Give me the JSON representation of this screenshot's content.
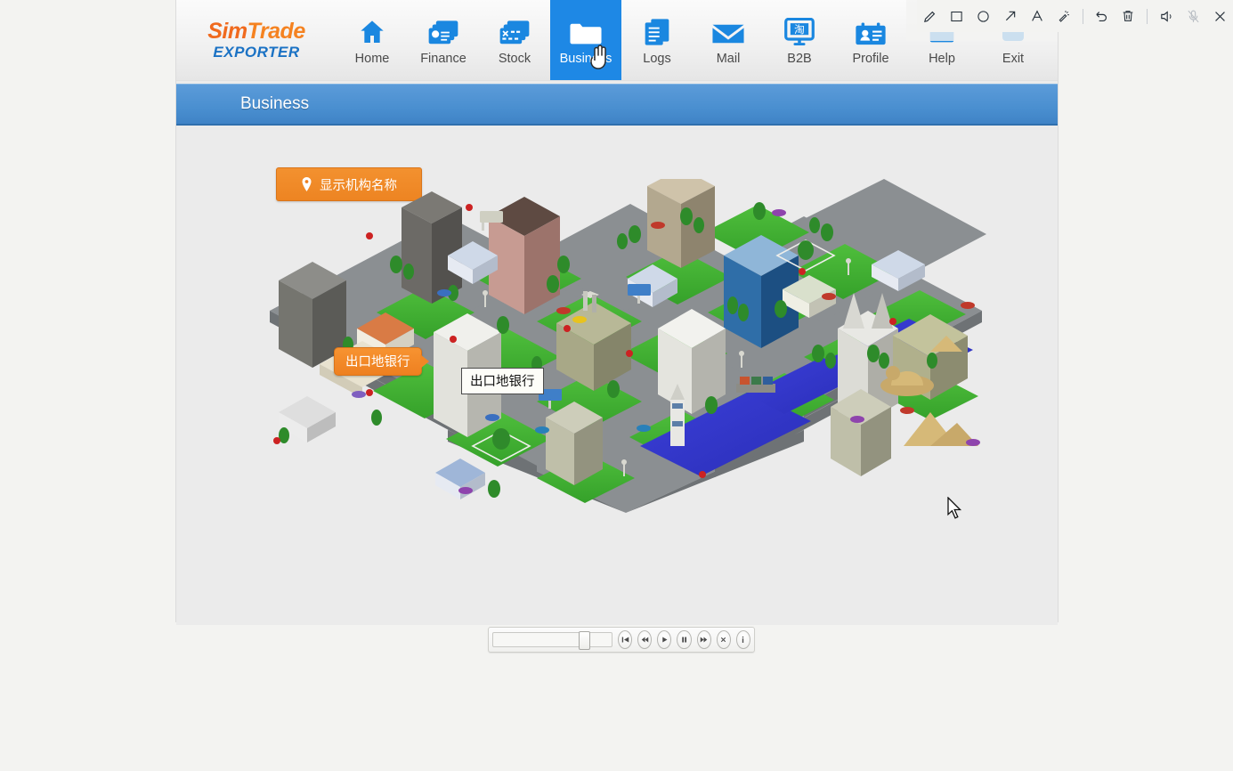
{
  "recorder_toolbar": {
    "buttons": [
      {
        "name": "pencil-icon",
        "label": "Pencil",
        "enabled": true
      },
      {
        "name": "rectangle-icon",
        "label": "Rectangle",
        "enabled": true
      },
      {
        "name": "ellipse-icon",
        "label": "Ellipse",
        "enabled": true
      },
      {
        "name": "arrow-icon",
        "label": "Arrow",
        "enabled": true
      },
      {
        "name": "text-icon",
        "label": "A",
        "enabled": true
      },
      {
        "name": "magic-wand-icon",
        "label": "Highlight",
        "enabled": true
      },
      {
        "name": "undo-icon",
        "label": "Undo",
        "enabled": true
      },
      {
        "name": "trash-icon",
        "label": "Delete",
        "enabled": true
      },
      {
        "name": "speaker-icon",
        "label": "Speaker",
        "enabled": true
      },
      {
        "name": "microphone-muted-icon",
        "label": "Microphone muted",
        "enabled": false
      },
      {
        "name": "close-icon",
        "label": "Close",
        "enabled": true
      }
    ]
  },
  "app": {
    "logo": {
      "line1_a": "Sim",
      "line1_b": "Trade",
      "line2": "EXPORTER"
    },
    "nav": {
      "items": [
        {
          "label": "Home",
          "icon": "home-icon",
          "active": false
        },
        {
          "label": "Finance",
          "icon": "finance-icon",
          "active": false
        },
        {
          "label": "Stock",
          "icon": "stock-icon",
          "active": false
        },
        {
          "label": "Business",
          "icon": "folder-icon",
          "active": true
        },
        {
          "label": "Logs",
          "icon": "logs-icon",
          "active": false
        },
        {
          "label": "Mail",
          "icon": "mail-icon",
          "active": false
        },
        {
          "label": "B2B",
          "icon": "monitor-icon",
          "active": false
        },
        {
          "label": "Profile",
          "icon": "id-card-icon",
          "active": false
        },
        {
          "label": "Help",
          "icon": "help-icon",
          "active": false
        },
        {
          "label": "Exit",
          "icon": "exit-icon",
          "active": false
        }
      ]
    },
    "page": {
      "title": "Business"
    },
    "show_names_button": {
      "label": "显示机构名称",
      "icon": "map-pin-icon"
    },
    "map": {
      "labels": [
        {
          "text": "出口地银行",
          "style": "orange-callout"
        },
        {
          "text": "出口地银行",
          "style": "white-tooltip"
        }
      ]
    }
  },
  "media_controls": {
    "slider_position_percent": 72,
    "buttons": [
      {
        "name": "skip-back-button",
        "glyph": "⏮"
      },
      {
        "name": "rewind-button",
        "glyph": "⏪"
      },
      {
        "name": "play-button",
        "glyph": "▶"
      },
      {
        "name": "pause-button",
        "glyph": "⏸"
      },
      {
        "name": "fast-forward-button",
        "glyph": "⏩"
      },
      {
        "name": "stop-close-button",
        "glyph": "✕"
      },
      {
        "name": "info-button",
        "glyph": "i"
      }
    ]
  },
  "colors": {
    "accent_blue": "#1e88e5",
    "title_bar_blue": "#4a8fd0",
    "brand_orange": "#f06a1e",
    "brand_blue": "#1b72c4",
    "button_orange": "#ee8020",
    "content_bg": "#ebebeb",
    "desktop_bg": "#f3f3f1"
  }
}
